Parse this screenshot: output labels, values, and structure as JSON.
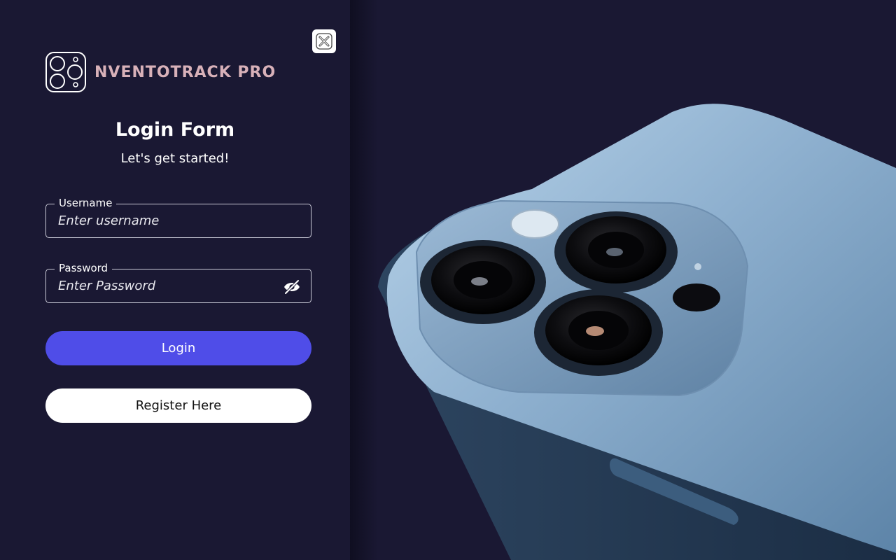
{
  "brand": {
    "name": "NVENTOTRACK PRO",
    "logo_icon": "camera-module-icon",
    "color": "#d8b1b9"
  },
  "form": {
    "title": "Login Form",
    "subtitle": "Let's get started!",
    "username": {
      "label": "Username",
      "placeholder": "Enter username",
      "value": ""
    },
    "password": {
      "label": "Password",
      "placeholder": "Enter Password",
      "value": "",
      "toggle_icon": "eye-off-icon"
    }
  },
  "buttons": {
    "close_icon": "close-icon",
    "login_label": "Login",
    "register_label": "Register Here"
  },
  "colors": {
    "background": "#1a1833",
    "accent": "#4f4de8",
    "phone_body": "#8fb3d2"
  }
}
